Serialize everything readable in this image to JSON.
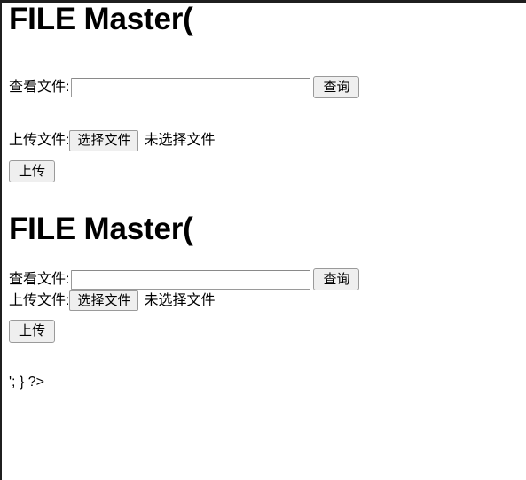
{
  "page": {
    "background_color": "#ffffff",
    "edge_color": "#1f1f1f"
  },
  "sections": [
    {
      "heading": "FILE Master(",
      "view_row": {
        "label": "查看文件:",
        "input_value": "",
        "input_placeholder": "",
        "submit_label": "查询"
      },
      "upload_row": {
        "label": "上传文件:",
        "choose_label": "选择文件",
        "no_file_text": "未选择文件",
        "upload_label": "上传"
      }
    },
    {
      "heading": "FILE Master(",
      "view_row": {
        "label": "查看文件:",
        "input_value": "",
        "input_placeholder": "",
        "submit_label": "查询"
      },
      "upload_row": {
        "label": "上传文件:",
        "choose_label": "选择文件",
        "no_file_text": "未选择文件",
        "upload_label": "上传"
      }
    }
  ],
  "trailing_code": "'; } ?>"
}
